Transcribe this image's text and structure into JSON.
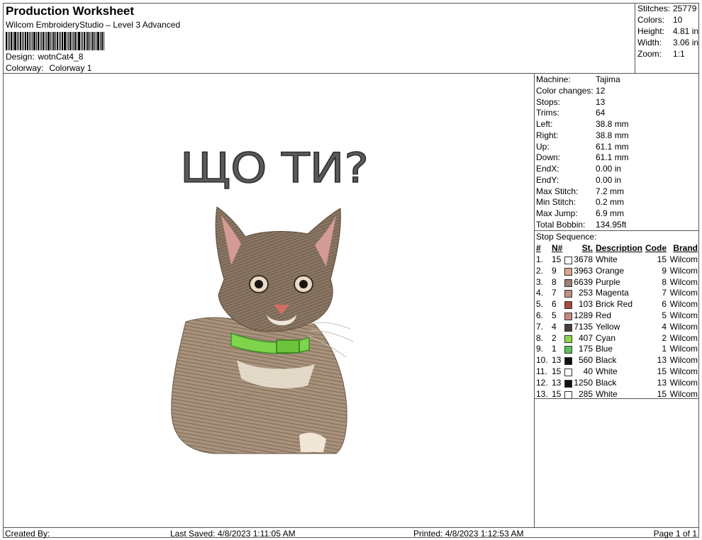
{
  "header": {
    "title": "Production Worksheet",
    "subtitle": "Wilcom EmbroideryStudio – Level 3 Advanced",
    "design_label": "Design:",
    "design_value": "wotnCat4_8",
    "colorway_label": "Colorway:",
    "colorway_value": "Colorway 1"
  },
  "summary": [
    {
      "k": "Stitches:",
      "v": "25779"
    },
    {
      "k": "Colors:",
      "v": "10"
    },
    {
      "k": "Height:",
      "v": "4.81 in"
    },
    {
      "k": "Width:",
      "v": "3.06 in"
    },
    {
      "k": "Zoom:",
      "v": "1:1"
    }
  ],
  "design": {
    "caption": "ЩО ТИ?"
  },
  "machine_info": [
    {
      "k": "Machine:",
      "v": "Tajima"
    },
    {
      "k": "Color changes:",
      "v": "12"
    },
    {
      "k": "Stops:",
      "v": "13"
    },
    {
      "k": "Trims:",
      "v": "64"
    },
    {
      "k": "Left:",
      "v": "38.8 mm"
    },
    {
      "k": "Right:",
      "v": "38.8 mm"
    },
    {
      "k": "Up:",
      "v": "61.1 mm"
    },
    {
      "k": "Down:",
      "v": "61.1 mm"
    },
    {
      "k": "EndX:",
      "v": "0.00 in"
    },
    {
      "k": "EndY:",
      "v": "0.00 in"
    },
    {
      "k": "Max Stitch:",
      "v": "7.2 mm"
    },
    {
      "k": "Min Stitch:",
      "v": "0.2 mm"
    },
    {
      "k": "Max Jump:",
      "v": "6.9 mm"
    },
    {
      "k": "Total Bobbin:",
      "v": "134.95ft"
    }
  ],
  "stop_sequence": {
    "title": "Stop Sequence:",
    "headers": {
      "idx": "#",
      "n": "N#",
      "st": "St.",
      "desc": "Description",
      "code": "Code",
      "brand": "Brand"
    },
    "rows": [
      {
        "idx": "1.",
        "n": "15",
        "color": "#ffffff",
        "st": "3678",
        "desc": "White",
        "code": "15",
        "brand": "Wilcom"
      },
      {
        "idx": "2.",
        "n": "9",
        "color": "#d9a58f",
        "st": "3963",
        "desc": "Orange",
        "code": "9",
        "brand": "Wilcom"
      },
      {
        "idx": "3.",
        "n": "8",
        "color": "#9a8275",
        "st": "6639",
        "desc": "Purple",
        "code": "8",
        "brand": "Wilcom"
      },
      {
        "idx": "4.",
        "n": "7",
        "color": "#c09080",
        "st": "253",
        "desc": "Magenta",
        "code": "7",
        "brand": "Wilcom"
      },
      {
        "idx": "5.",
        "n": "6",
        "color": "#a84a3e",
        "st": "103",
        "desc": "Brick Red",
        "code": "6",
        "brand": "Wilcom"
      },
      {
        "idx": "6.",
        "n": "5",
        "color": "#c48a80",
        "st": "1289",
        "desc": "Red",
        "code": "5",
        "brand": "Wilcom"
      },
      {
        "idx": "7.",
        "n": "4",
        "color": "#4a3f38",
        "st": "7135",
        "desc": "Yellow",
        "code": "4",
        "brand": "Wilcom"
      },
      {
        "idx": "8.",
        "n": "2",
        "color": "#8cd84a",
        "st": "407",
        "desc": "Cyan",
        "code": "2",
        "brand": "Wilcom"
      },
      {
        "idx": "9.",
        "n": "1",
        "color": "#5cc05a",
        "st": "175",
        "desc": "Blue",
        "code": "1",
        "brand": "Wilcom"
      },
      {
        "idx": "10.",
        "n": "13",
        "color": "#111111",
        "st": "560",
        "desc": "Black",
        "code": "13",
        "brand": "Wilcom"
      },
      {
        "idx": "11.",
        "n": "15",
        "color": "#ffffff",
        "st": "40",
        "desc": "White",
        "code": "15",
        "brand": "Wilcom"
      },
      {
        "idx": "12.",
        "n": "13",
        "color": "#111111",
        "st": "1250",
        "desc": "Black",
        "code": "13",
        "brand": "Wilcom"
      },
      {
        "idx": "13.",
        "n": "15",
        "color": "#ffffff",
        "st": "285",
        "desc": "White",
        "code": "15",
        "brand": "Wilcom"
      }
    ]
  },
  "footer": {
    "created_by": "Created By:",
    "last_saved": "Last Saved: 4/8/2023 1:11:05 AM",
    "printed": "Printed: 4/8/2023 1:12:53 AM",
    "page": "Page 1 of 1"
  }
}
